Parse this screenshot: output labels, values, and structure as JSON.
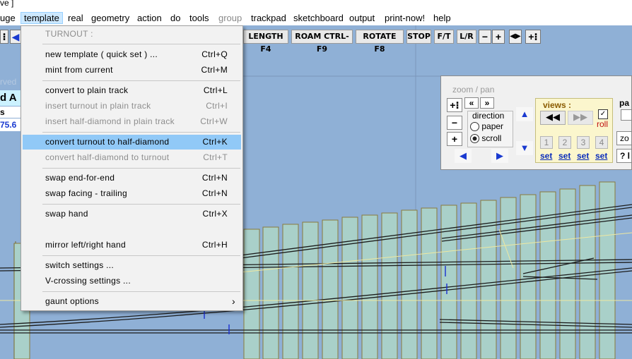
{
  "window": {
    "title_fragment": "ve ]"
  },
  "menubar": {
    "items": [
      {
        "label": "uge"
      },
      {
        "label": "template"
      },
      {
        "label": "real"
      },
      {
        "label": "geometry"
      },
      {
        "label": "action"
      },
      {
        "label": "do"
      },
      {
        "label": "tools"
      },
      {
        "label": "group"
      },
      {
        "label": "trackpad"
      },
      {
        "label": "sketchboard"
      },
      {
        "label": "output"
      },
      {
        "label": "print-now!"
      },
      {
        "label": "help"
      }
    ]
  },
  "toolbar": {
    "length_label": "LENGTH F4",
    "roam_label": "ROAM CTRL-F9",
    "rotate_label": "ROTATE F8",
    "stop_label": "STOP",
    "ft_label": "F/T",
    "lr_label": "L/R"
  },
  "leftpanel": {
    "line1": "rved",
    "line2": "d A",
    "line3": "s nov",
    "line4": "75.6"
  },
  "dropdown": {
    "header": "TURNOUT :",
    "items": [
      {
        "label": "new template ( quick set ) ...",
        "shortcut": "Ctrl+Q"
      },
      {
        "label": "mint from current",
        "shortcut": "Ctrl+M"
      },
      {
        "label": "convert to plain track",
        "shortcut": "Ctrl+L"
      },
      {
        "label": "insert turnout in plain track",
        "shortcut": "Ctrl+I"
      },
      {
        "label": "insert half-diamond in plain track",
        "shortcut": "Ctrl+W"
      },
      {
        "label": "convert turnout to half-diamond",
        "shortcut": "Ctrl+K"
      },
      {
        "label": "convert half-diamond to turnout",
        "shortcut": "Ctrl+T"
      },
      {
        "label": "swap end-for-end",
        "shortcut": "Ctrl+N"
      },
      {
        "label": "swap facing - trailing",
        "shortcut": "Ctrl+N"
      },
      {
        "label": "swap hand",
        "shortcut": "Ctrl+X"
      },
      {
        "label": "mirror left/right hand",
        "shortcut": "Ctrl+H"
      },
      {
        "label": "switch settings ...",
        "shortcut": ""
      },
      {
        "label": "V-crossing settings ...",
        "shortcut": ""
      },
      {
        "label": "gaunt options",
        "shortcut": "›"
      }
    ]
  },
  "zoompan": {
    "title": "zoom / pan",
    "direction_label": "direction",
    "paper_label": "paper",
    "scroll_label": "scroll",
    "views_label": "views :",
    "roll_label": "roll",
    "view_numbers": [
      "1",
      "2",
      "3",
      "4"
    ],
    "set_label": "set",
    "pan_label": "pa",
    "zo_label": "zo",
    "help_label": "? l"
  },
  "colors": {
    "canvas": "#8fb0d6",
    "highlight": "#91c9f7",
    "menu_active": "#cce8ff"
  }
}
